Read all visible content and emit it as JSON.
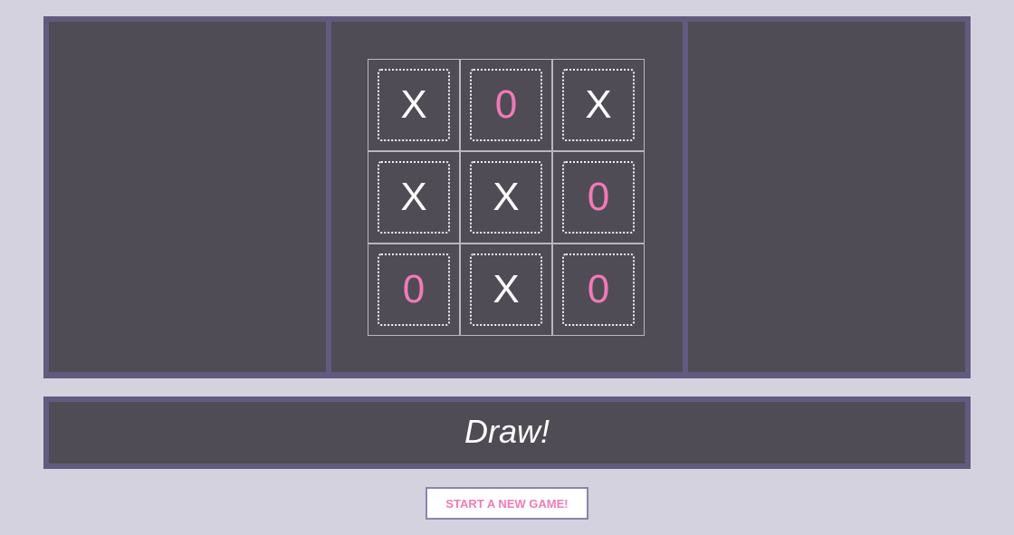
{
  "board": {
    "cells": [
      {
        "mark": "X",
        "player": "x"
      },
      {
        "mark": "0",
        "player": "o"
      },
      {
        "mark": "X",
        "player": "x"
      },
      {
        "mark": "X",
        "player": "x"
      },
      {
        "mark": "X",
        "player": "x"
      },
      {
        "mark": "0",
        "player": "o"
      },
      {
        "mark": "0",
        "player": "o"
      },
      {
        "mark": "X",
        "player": "x"
      },
      {
        "mark": "0",
        "player": "o"
      }
    ]
  },
  "status": {
    "message": "Draw!"
  },
  "controls": {
    "new_game_label": "START A NEW GAME!"
  },
  "colors": {
    "background": "#d3d2de",
    "frame": "#635a7f",
    "panel": "#4f4c56",
    "x_mark": "#ffffff",
    "o_mark": "#f27ab8"
  }
}
